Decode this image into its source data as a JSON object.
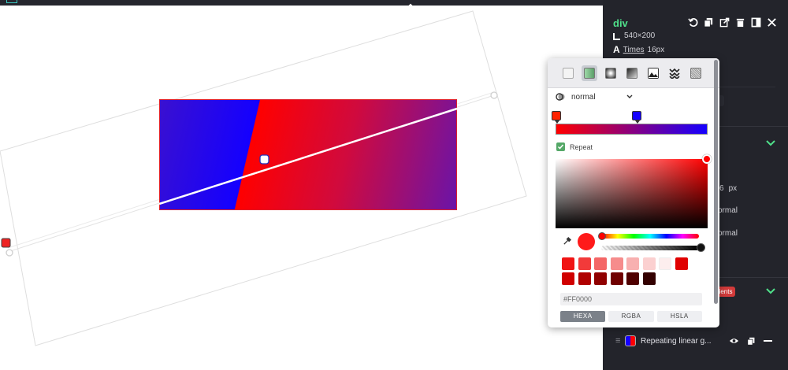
{
  "panel": {
    "element_name": "div",
    "size": "540×200",
    "font_family": "Times",
    "font_size": "16px",
    "px_value": "6",
    "px_unit": "px",
    "normal_a": "ormal",
    "normal_b": "ormal",
    "gradients_badge": "radients",
    "layer_name": "Repeating linear g...",
    "colors": {
      "bg": "#23242b",
      "accent": "#4fe08a",
      "badge": "#d23a3a"
    }
  },
  "popup": {
    "blend_mode": "normal",
    "repeat_label": "Repeat",
    "gradient_start_color": "#ff0000",
    "gradient_end_color": "#1400ff",
    "hex_value": "#FF0000",
    "modes": [
      "HEXA",
      "RGBA",
      "HSLA"
    ],
    "active_mode": "HEXA",
    "swatches": [
      "#f01414",
      "#f23a3a",
      "#f46666",
      "#f68c8c",
      "#f8b0b0",
      "#fbd0d0",
      "#fdeeee",
      "#e00000",
      "#d00000",
      "#b00000",
      "#900000",
      "#700000",
      "#500000",
      "#330000"
    ]
  },
  "canvas": {
    "gradient_colors": [
      "#1400ff",
      "#ff0000",
      "#6a14a8"
    ]
  }
}
